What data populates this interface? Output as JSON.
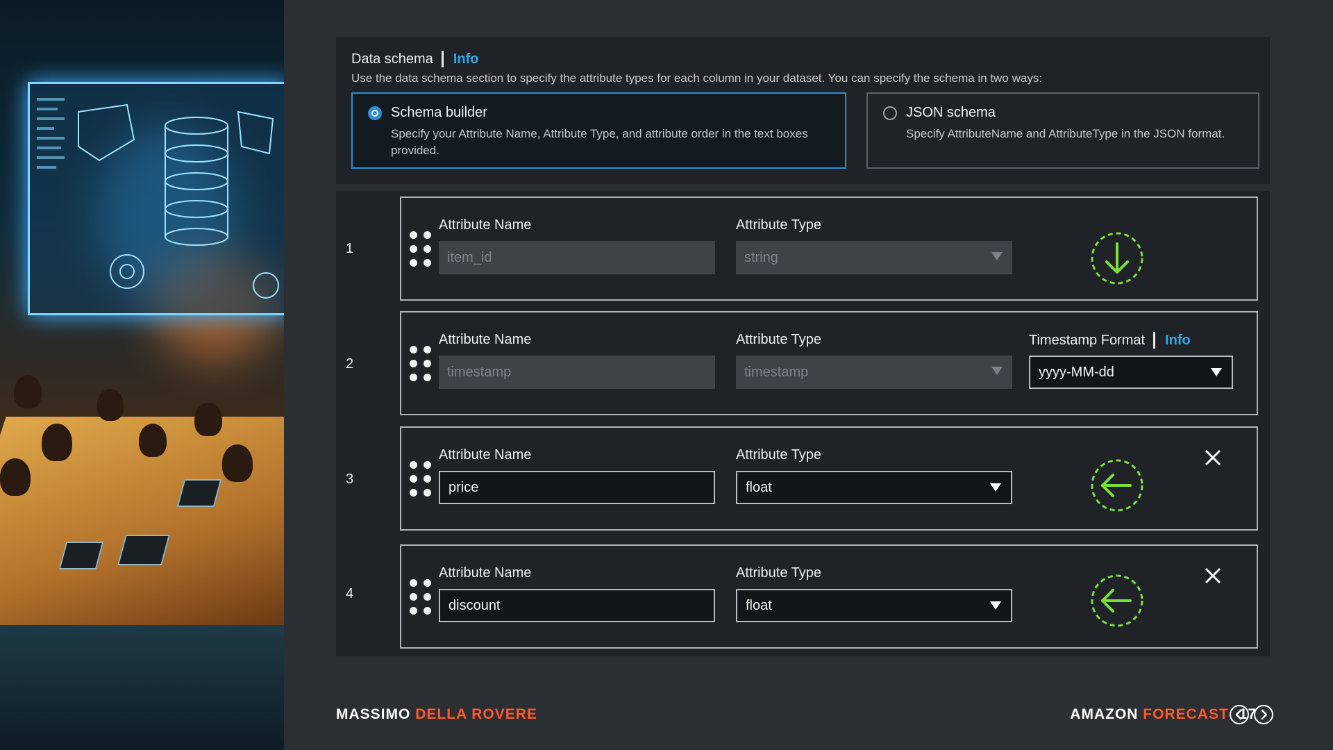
{
  "schema_panel": {
    "title": "Data schema",
    "info": "Info",
    "description": "Use the data schema section to specify the attribute types for each column in your dataset. You can specify the schema in two ways:",
    "options": [
      {
        "title": "Schema builder",
        "description": "Specify your Attribute Name, Attribute Type, and attribute order in the text boxes provided.",
        "selected": true
      },
      {
        "title": "JSON schema",
        "description": "Specify AttributeName and AttributeType in the JSON format.",
        "selected": false
      }
    ]
  },
  "rows": [
    {
      "number": "1",
      "name_label": "Attribute Name",
      "name_value": "item_id",
      "type_label": "Attribute Type",
      "type_value": "string",
      "editable": false,
      "icon": "arrow-down-icon"
    },
    {
      "number": "2",
      "name_label": "Attribute Name",
      "name_value": "timestamp",
      "type_label": "Attribute Type",
      "type_value": "timestamp",
      "editable": false,
      "timestamp_format_label": "Timestamp Format",
      "timestamp_info": "Info",
      "timestamp_format_value": "yyyy-MM-dd"
    },
    {
      "number": "3",
      "name_label": "Attribute Name",
      "name_value": "price",
      "type_label": "Attribute Type",
      "type_value": "float",
      "editable": true,
      "icon": "arrow-left-icon",
      "removable": true
    },
    {
      "number": "4",
      "name_label": "Attribute Name",
      "name_value": "discount",
      "type_label": "Attribute Type",
      "type_value": "float",
      "editable": true,
      "icon": "arrow-left-icon",
      "removable": true
    }
  ],
  "footer": {
    "author_first": "MASSIMO",
    "author_last": "DELLA ROVERE",
    "product_first": "AMAZON",
    "product_last": "FORECAST",
    "page": "17"
  },
  "colors": {
    "accent": "#ff5a2a",
    "info_link": "#29a9e8",
    "selected_border": "#2a8fd6",
    "icon_green": "#7be03a"
  }
}
